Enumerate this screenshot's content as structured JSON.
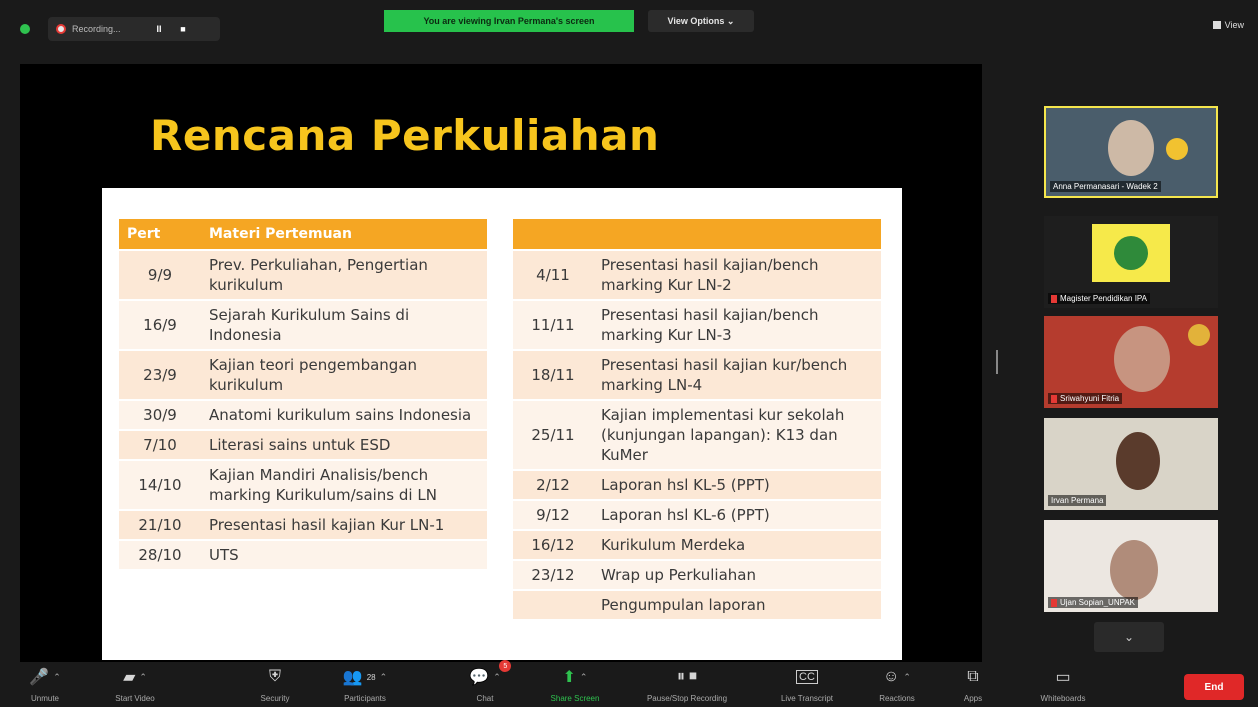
{
  "topbar": {
    "recording_label": "Recording...",
    "pause_glyph": "II",
    "stop_glyph": "■",
    "viewing_banner": "You are viewing Irvan Permana's screen",
    "view_options": "View Options ⌄",
    "view_label": "View"
  },
  "slide": {
    "title": "Rencana Perkuliahan",
    "left_table": {
      "headers": [
        "Pert",
        "Materi Pertemuan"
      ],
      "rows": [
        [
          "9/9",
          "Prev. Perkuliahan, Pengertian kurikulum"
        ],
        [
          "16/9",
          "Sejarah Kurikulum Sains di Indonesia"
        ],
        [
          "23/9",
          "Kajian teori pengembangan kurikulum"
        ],
        [
          "30/9",
          "Anatomi kurikulum sains Indonesia"
        ],
        [
          "7/10",
          "Literasi sains untuk ESD"
        ],
        [
          "14/10",
          "Kajian Mandiri Analisis/bench marking Kurikulum/sains di LN"
        ],
        [
          "21/10",
          "Presentasi hasil kajian Kur LN-1"
        ],
        [
          "28/10",
          "UTS"
        ]
      ]
    },
    "right_table": {
      "headers": [
        "",
        ""
      ],
      "rows": [
        [
          "4/11",
          "Presentasi hasil kajian/bench marking Kur LN-2"
        ],
        [
          "11/11",
          "Presentasi hasil kajian/bench marking Kur LN-3"
        ],
        [
          "18/11",
          "Presentasi hasil kajian kur/bench marking LN-4"
        ],
        [
          "25/11",
          "Kajian implementasi kur sekolah (kunjungan lapangan): K13 dan KuMer"
        ],
        [
          "2/12",
          "Laporan hsl KL-5 (PPT)"
        ],
        [
          "9/12",
          "Laporan hsl KL-6 (PPT)"
        ],
        [
          "16/12",
          "Kurikulum Merdeka"
        ],
        [
          "23/12",
          "Wrap up Perkuliahan"
        ],
        [
          "",
          "Pengumpulan laporan"
        ]
      ]
    }
  },
  "participants": [
    {
      "name": "Anna Permanasari - Wadek 2",
      "muted": false,
      "active": true
    },
    {
      "name": "Magister Pendidikan IPA",
      "muted": true,
      "active": false
    },
    {
      "name": "Sriwahyuni Fitria",
      "muted": true,
      "active": false
    },
    {
      "name": "Irvan Permana",
      "muted": false,
      "active": false
    },
    {
      "name": "Ujan Sopian_UNPAK",
      "muted": true,
      "active": false
    }
  ],
  "toolbar": {
    "unmute": "Unmute",
    "start_video": "Start Video",
    "security": "Security",
    "participants": "Participants",
    "participants_count": "28",
    "chat": "Chat",
    "chat_badge": "5",
    "share_screen": "Share Screen",
    "pause_stop_recording": "Pause/Stop Recording",
    "live_transcript": "Live Transcript",
    "reactions": "Reactions",
    "apps": "Apps",
    "whiteboards": "Whiteboards",
    "end": "End"
  },
  "colors": {
    "accent_green": "#27c24c",
    "slide_title": "#f7c51d",
    "table_header": "#f5a623",
    "end_red": "#e02828"
  }
}
